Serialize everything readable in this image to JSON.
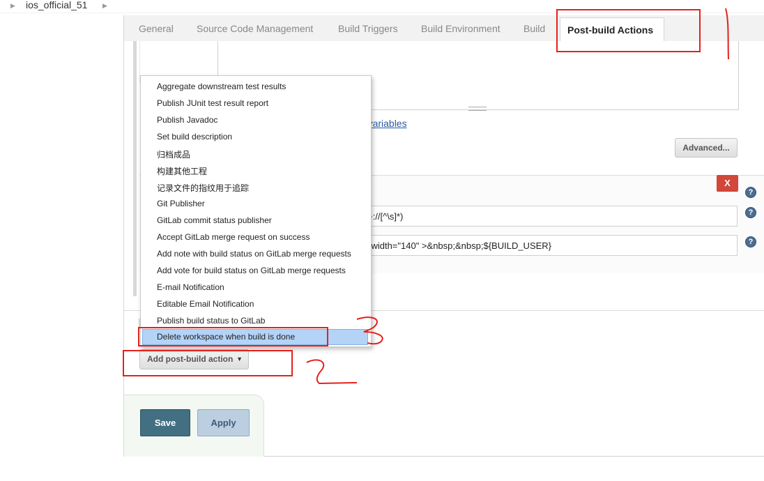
{
  "breadcrumb": {
    "job": "ios_official_51"
  },
  "tabs": [
    {
      "label": "General"
    },
    {
      "label": "Source Code Management"
    },
    {
      "label": "Build Triggers"
    },
    {
      "label": "Build Environment"
    },
    {
      "label": "Build"
    },
    {
      "label": "Post-build Actions",
      "active": true
    }
  ],
  "form": {
    "env_link_partial": "nt variables",
    "advanced_label": "Advanced...",
    "delete_label": "X",
    "help_label": "?",
    "field1_value": "z]+://[^\\s]*)",
    "field2_value": "0\" width=\"140\" >&nbsp;&nbsp;${BUILD_USER}"
  },
  "menu": {
    "items": [
      "Aggregate downstream test results",
      "Publish JUnit test result report",
      "Publish Javadoc",
      "Set build description",
      "归档成品",
      "构建其他工程",
      "记录文件的指纹用于追踪",
      "Git Publisher",
      "GitLab commit status publisher",
      "Accept GitLab merge request on success",
      "Add note with build status on GitLab merge requests",
      "Add vote for build status on GitLab merge requests",
      "E-mail Notification",
      "Editable Email Notification",
      "Publish build status to GitLab",
      "Delete workspace when build is done"
    ],
    "highlighted": "Delete workspace when build is done"
  },
  "buttons": {
    "add_post_build": "Add post-build action",
    "save": "Save",
    "apply": "Apply"
  },
  "colors": {
    "annotation_red": "#e5201c",
    "save_bg": "#426f81",
    "apply_bg": "#bccfe0",
    "delete_bg": "#d24739",
    "highlight_bg": "#b3d3f7",
    "link": "#2a5aa2"
  }
}
